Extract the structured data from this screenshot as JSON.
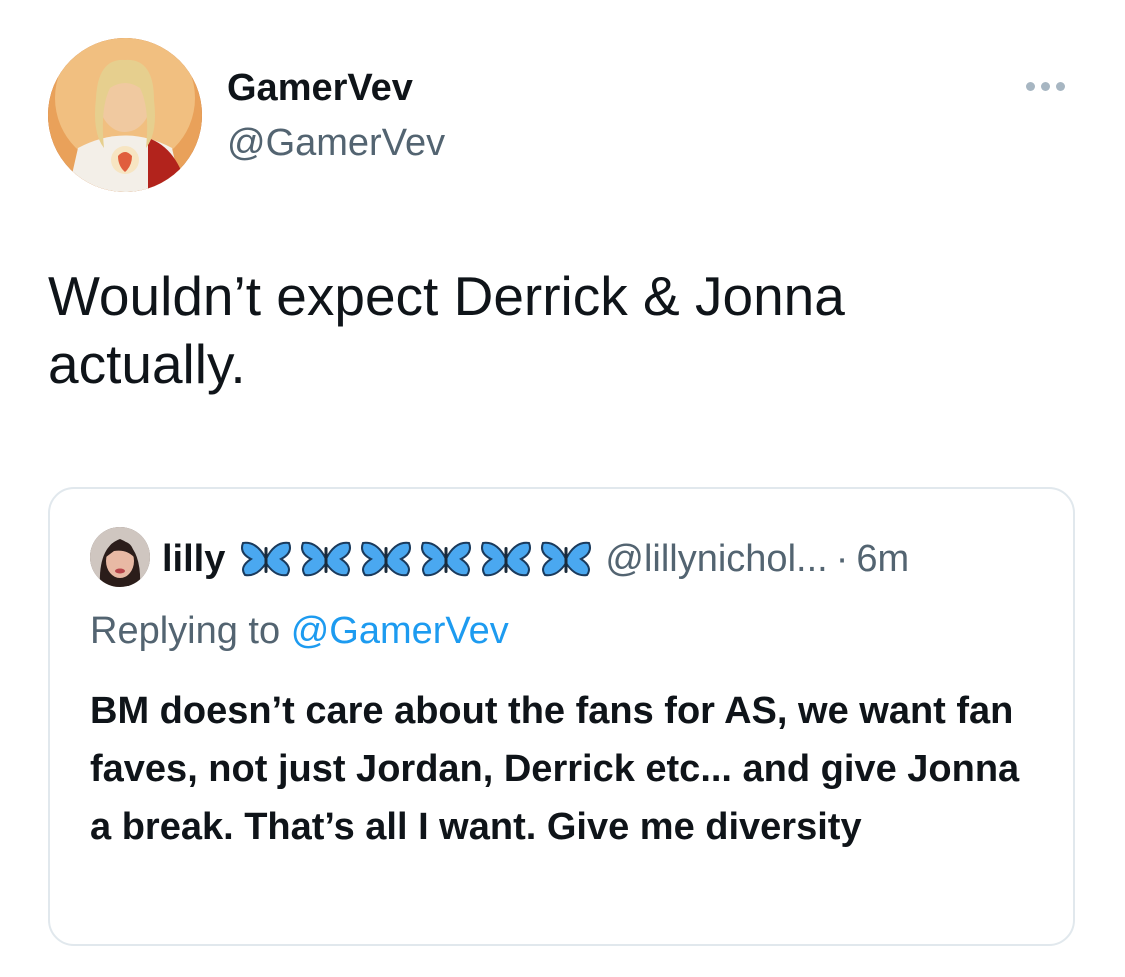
{
  "tweet": {
    "author": {
      "display_name": "GamerVev",
      "handle": "@GamerVev",
      "avatar": "avatar-image"
    },
    "more_icon": "more-horizontal-icon",
    "text": "Wouldn’t expect Derrick & Jonna actually."
  },
  "quoted_tweet": {
    "author": {
      "display_name": "lilly",
      "handle": "@lillynichol...",
      "avatar": "avatar-image"
    },
    "emoji": [
      "butterfly-emoji",
      "butterfly-emoji",
      "butterfly-emoji",
      "butterfly-emoji",
      "butterfly-emoji",
      "butterfly-emoji"
    ],
    "separator": "·",
    "time": "6m",
    "replying_prefix": "Replying to",
    "replying_to": "@GamerVev",
    "text": "BM doesn’t care about the fans for AS, we want fan faves, not just Jordan, Derrick etc... and give Jonna a break. That’s all I want. Give me diversity"
  },
  "colors": {
    "text": "#0f1419",
    "secondary": "#536471",
    "link": "#1d9bf0",
    "border": "#e1e8ed",
    "butterfly": "#4aa8f0"
  }
}
